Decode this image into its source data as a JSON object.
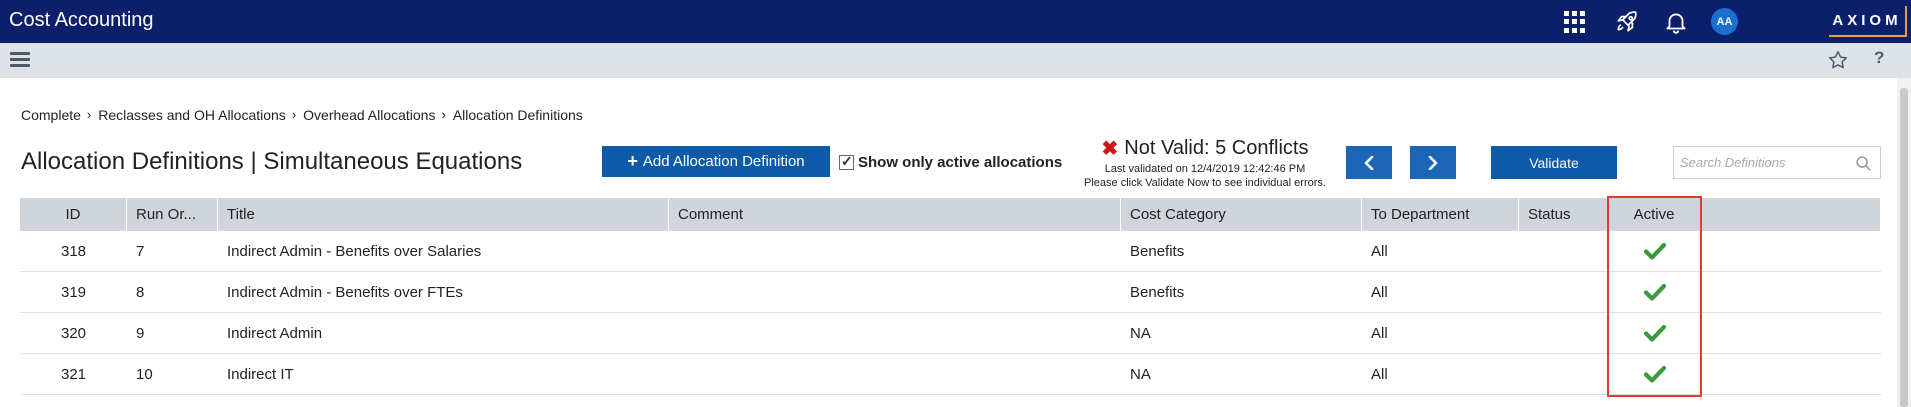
{
  "app": {
    "title": "Cost Accounting",
    "avatar_initials": "AA",
    "logo_text": "AXIOM"
  },
  "topbar_icons": [
    "apps-grid-icon",
    "rocket-icon",
    "bell-icon"
  ],
  "subbar_icons": [
    "hamburger-icon",
    "star-icon",
    "help-icon"
  ],
  "breadcrumb": [
    "Complete",
    "Reclasses and OH Allocations",
    "Overhead Allocations",
    "Allocation Definitions"
  ],
  "page_title": "Allocation Definitions | Simultaneous Equations",
  "toolbar": {
    "add_label": "Add Allocation Definition",
    "show_active_label": "Show only active allocations",
    "show_active_checked": true,
    "validate_label": "Validate",
    "search_placeholder": "Search Definitions"
  },
  "validation": {
    "status": "Not Valid: 5 Conflicts",
    "last_validated": "Last validated on 12/4/2019 12:42:46 PM",
    "hint": "Please click Validate Now to see individual errors."
  },
  "table": {
    "columns": [
      "ID",
      "Run Or...",
      "Title",
      "Comment",
      "Cost Category",
      "To Department",
      "Status",
      "Active"
    ],
    "rows": [
      {
        "id": "318",
        "run_order": "7",
        "title": "Indirect Admin - Benefits over Salaries",
        "comment": "",
        "cost_category": "Benefits",
        "to_department": "All",
        "status": "",
        "active": true
      },
      {
        "id": "319",
        "run_order": "8",
        "title": "Indirect Admin - Benefits over FTEs",
        "comment": "",
        "cost_category": "Benefits",
        "to_department": "All",
        "status": "",
        "active": true
      },
      {
        "id": "320",
        "run_order": "9",
        "title": "Indirect Admin",
        "comment": "",
        "cost_category": "NA",
        "to_department": "All",
        "status": "",
        "active": true
      },
      {
        "id": "321",
        "run_order": "10",
        "title": "Indirect IT",
        "comment": "",
        "cost_category": "NA",
        "to_department": "All",
        "status": "",
        "active": true
      }
    ]
  },
  "colors": {
    "topbar": "#0b1f6b",
    "primary_button": "#0d5ba8",
    "error": "#d01515",
    "success": "#3a9b3a",
    "highlight": "#e53935"
  }
}
